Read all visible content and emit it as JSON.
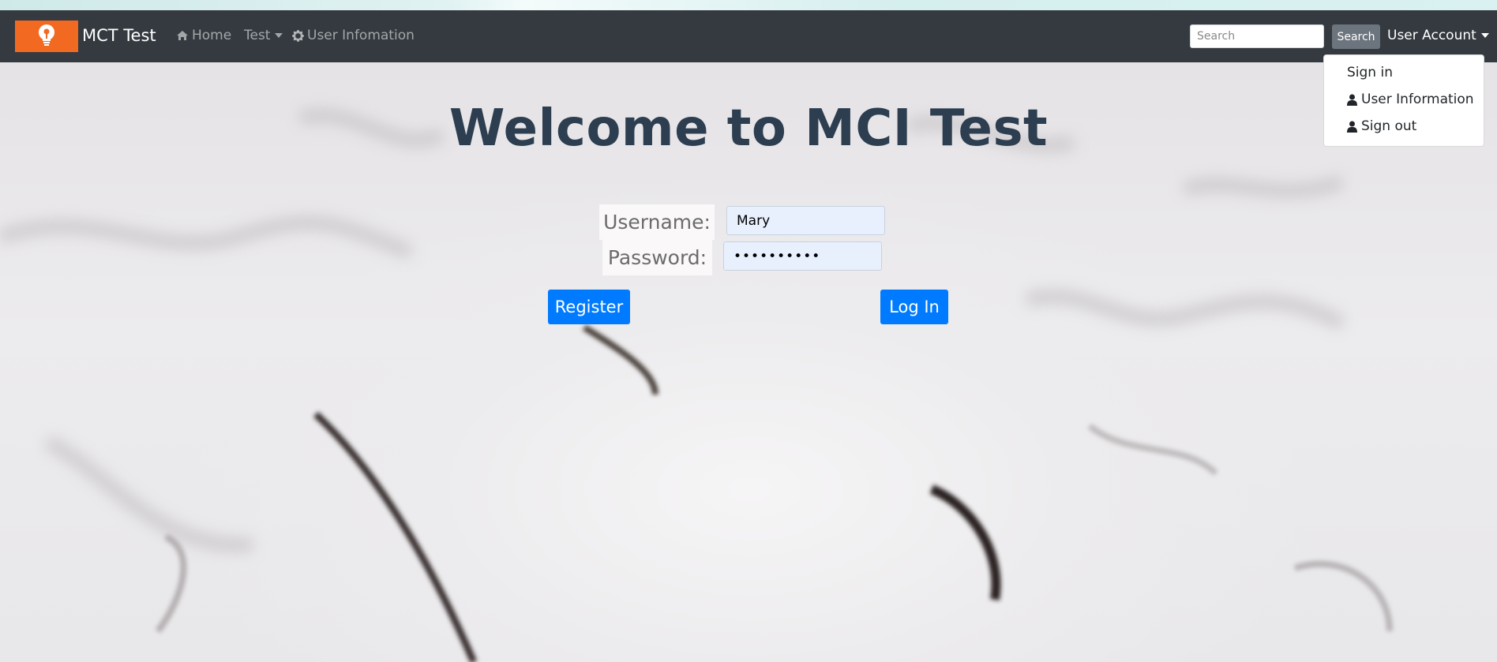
{
  "app": {
    "brand": "MCT Test",
    "brand_color": "#f26a21",
    "navbar_color": "#343a40"
  },
  "nav": {
    "home_label": "Home",
    "test_label": "Test",
    "user_info_label": "User Infomation"
  },
  "search": {
    "placeholder": "Search",
    "button_label": "Search"
  },
  "account": {
    "toggle_label": "User Account",
    "menu": [
      {
        "label": "Sign in",
        "icon": ""
      },
      {
        "label": "User Information",
        "icon": "user-icon"
      },
      {
        "label": "Sign out",
        "icon": "user-icon"
      }
    ]
  },
  "main": {
    "title": "Welcome to MCI Test",
    "username_label": "Username:",
    "username_value": "Mary",
    "password_label": "Password:",
    "password_value": "••••••••••",
    "register_label": "Register",
    "login_label": "Log In",
    "primary_color": "#007bff"
  }
}
